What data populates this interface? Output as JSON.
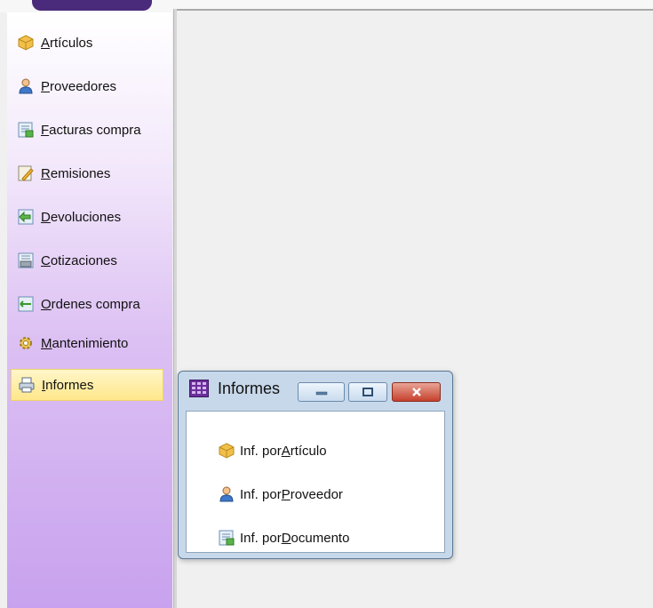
{
  "sidebar": {
    "items": [
      {
        "key": "articulos",
        "accel": "A",
        "rest": "rtículos",
        "icon": "box-icon"
      },
      {
        "key": "proveedores",
        "accel": "P",
        "rest": "roveedores",
        "icon": "person-icon"
      },
      {
        "key": "facturas",
        "accel": "F",
        "rest": "acturas compra",
        "icon": "invoice-icon"
      },
      {
        "key": "remisiones",
        "accel": "R",
        "rest": "emisiones",
        "icon": "edit-document-icon"
      },
      {
        "key": "devoluciones",
        "accel": "D",
        "rest": "evoluciones",
        "icon": "return-document-icon"
      },
      {
        "key": "cotizaciones",
        "accel": "C",
        "rest": "otizaciones",
        "icon": "quote-document-icon"
      },
      {
        "key": "ordenes",
        "accel": "O",
        "rest": "rdenes compra",
        "icon": "order-document-icon"
      },
      {
        "key": "mantenimiento",
        "accel": "M",
        "rest": "antenimiento",
        "icon": "maintenance-icon"
      },
      {
        "key": "informes",
        "accel": "I",
        "rest": "nformes",
        "icon": "printer-icon",
        "selected": true
      }
    ]
  },
  "window": {
    "title": "Informes",
    "items": [
      {
        "prefix": "Inf. por ",
        "accel": "A",
        "rest": "rtículo",
        "icon": "box-icon"
      },
      {
        "prefix": "Inf. por ",
        "accel": "P",
        "rest": "roveedor",
        "icon": "person-icon"
      },
      {
        "prefix": "Inf. por ",
        "accel": "D",
        "rest": "ocumento",
        "icon": "document-icon"
      }
    ]
  },
  "colors": {
    "selected": "#ffe78a",
    "sidebar_bottom": "#c8a2ee",
    "close_button": "#c5412d"
  }
}
